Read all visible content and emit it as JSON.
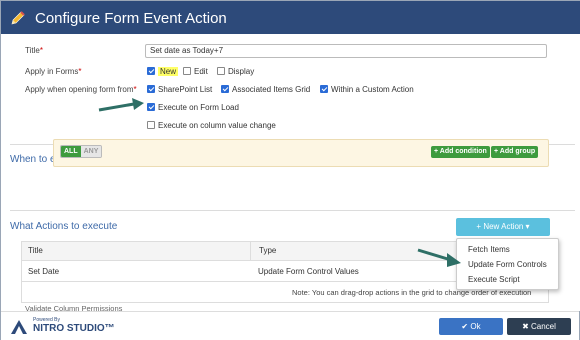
{
  "window": {
    "title": "Configure Form Event Action"
  },
  "form": {
    "title_label": "Title",
    "title_value": "Set date as Today+7",
    "apply_in_forms_label": "Apply in Forms",
    "forms": [
      {
        "label": "New",
        "checked": true
      },
      {
        "label": "Edit",
        "checked": false
      },
      {
        "label": "Display",
        "checked": false
      }
    ],
    "apply_when_label": "Apply when opening form from",
    "sources": [
      {
        "label": "SharePoint List",
        "checked": true
      },
      {
        "label": "Associated Items Grid",
        "checked": true
      },
      {
        "label": "Within a Custom Action",
        "checked": true
      }
    ],
    "execute_on_load": {
      "label": "Execute on Form Load",
      "checked": true
    },
    "execute_on_change": {
      "label": "Execute on column value change",
      "checked": false
    },
    "required_marker": "*"
  },
  "conditions": {
    "section_title": "When to execute Actions",
    "all_label": "ALL",
    "any_label": "ANY",
    "add_condition": "+ Add condition",
    "add_group": "+ Add group"
  },
  "actions": {
    "section_title": "What Actions to execute",
    "new_action": "+ New Action ▾",
    "columns": [
      "Title",
      "Type"
    ],
    "rows": [
      {
        "title": "Set Date",
        "type": "Update Form Control Values"
      }
    ],
    "note": "Note: You can drag-drop actions in the grid to change order of execution",
    "menu": [
      "Fetch Items",
      "Update Form Controls",
      "Execute Script"
    ]
  },
  "partial_text": "Validate Column Permissions",
  "footer": {
    "powered_by": "Powered By",
    "logo_text": "NITRO STUDIO™",
    "ok": "✔ Ok",
    "cancel": "✖ Cancel"
  },
  "colors": {
    "header": "#2d4a7a",
    "arrow": "#2e6f66",
    "ok": "#3a73c4",
    "cancel": "#2d3e52",
    "green": "#3e9b3e",
    "new_action": "#5bc0de"
  }
}
